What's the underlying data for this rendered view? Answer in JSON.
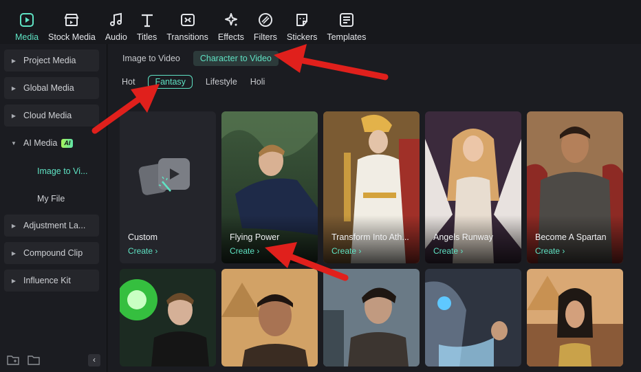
{
  "toolbar": {
    "items": [
      {
        "label": "Media",
        "icon": "media-icon"
      },
      {
        "label": "Stock Media",
        "icon": "stock-media-icon"
      },
      {
        "label": "Audio",
        "icon": "music-note-icon"
      },
      {
        "label": "Titles",
        "icon": "text-t-icon"
      },
      {
        "label": "Transitions",
        "icon": "transitions-icon"
      },
      {
        "label": "Effects",
        "icon": "sparkle-icon"
      },
      {
        "label": "Filters",
        "icon": "filters-icon"
      },
      {
        "label": "Stickers",
        "icon": "sticker-icon"
      },
      {
        "label": "Templates",
        "icon": "templates-icon"
      }
    ],
    "active_index": 0,
    "accent_color": "#5fe3c4"
  },
  "sidebar": {
    "items": [
      {
        "label": "Project Media"
      },
      {
        "label": "Global Media"
      },
      {
        "label": "Cloud Media"
      },
      {
        "label": "AI Media",
        "badge": "AI"
      },
      {
        "label": "Adjustment La..."
      },
      {
        "label": "Compound Clip"
      },
      {
        "label": "Influence Kit"
      }
    ],
    "sub_items": [
      {
        "label": "Image to Vi..."
      },
      {
        "label": "My File"
      }
    ],
    "collapse_glyph": "‹"
  },
  "main": {
    "top_tabs": [
      {
        "label": "Image to Video"
      },
      {
        "label": "Character to Video"
      }
    ],
    "sub_tabs": [
      {
        "label": "Hot"
      },
      {
        "label": "Fantasy"
      },
      {
        "label": "Lifestyle"
      },
      {
        "label": "Holi"
      }
    ],
    "cards_row1": [
      {
        "title": "Custom",
        "create": "Create ›"
      },
      {
        "title": "Flying Power",
        "create": "Create ›"
      },
      {
        "title": "Transform Into Ath...",
        "create": "Create ›"
      },
      {
        "title": "Angels Runway",
        "create": "Create ›"
      },
      {
        "title": "Become A Spartan",
        "create": "Create ›"
      }
    ]
  }
}
